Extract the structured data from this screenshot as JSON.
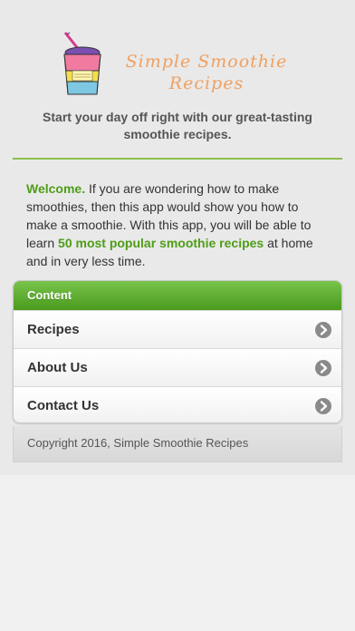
{
  "header": {
    "logo_line1": "Simple Smoothie",
    "logo_line2": "Recipes",
    "tagline": "Start your day off right with our great-tasting smoothie recipes."
  },
  "intro": {
    "welcome": "Welcome.",
    "text1": " If you are wondering how to make smoothies, then this app would show you how to make a smoothie. With this app, you will be able to learn ",
    "highlight": "50 most popular smoothie recipes",
    "text2": " at home and in very less time."
  },
  "content_card": {
    "title": "Content",
    "items": [
      {
        "label": "Recipes",
        "icon": "chevron-right-icon"
      },
      {
        "label": "About Us",
        "icon": "chevron-right-icon"
      },
      {
        "label": "Contact Us",
        "icon": "chevron-right-icon"
      }
    ]
  },
  "footer": {
    "copyright": "Copyright 2016, Simple Smoothie Recipes"
  },
  "colors": {
    "accent_green": "#4f9d17",
    "header_green": "#6db83c",
    "logo_orange": "#f0a060"
  }
}
